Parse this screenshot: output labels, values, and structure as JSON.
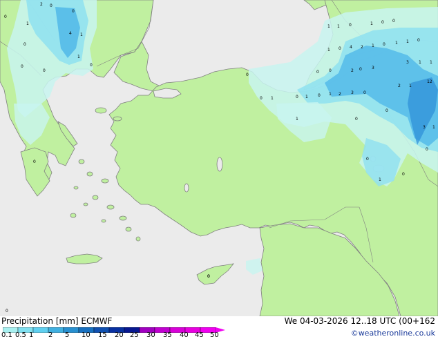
{
  "footer": {
    "title": "Precipitation [mm]  ECMWF",
    "datetime": "We 04-03-2026 12..18 UTC (00+162",
    "credit": "©weatheronline.co.uk"
  },
  "legend": {
    "ticks": [
      "0.1",
      "0.5",
      "1",
      "2",
      "5",
      "10",
      "15",
      "20",
      "25",
      "30",
      "35",
      "40",
      "45",
      "50"
    ],
    "colors": [
      "#a8f0f0",
      "#80e0f0",
      "#60d0f0",
      "#40b0e0",
      "#2890d0",
      "#1870c0",
      "#1050b0",
      "#0830a0",
      "#081890",
      "#a000c0",
      "#c000d0",
      "#d800d8",
      "#e800e0",
      "#f000f0"
    ]
  },
  "colors": {
    "sea": "#ebebeb",
    "land": "#c0f0a0",
    "coast": "#808080",
    "rain_light": "#c8f5f0",
    "rain_mid": "#8ee0f0",
    "rain_heavy": "#50b8e8",
    "rain_core": "#3090d8"
  },
  "precip_labels": [
    {
      "t": "0"
    },
    {
      "t": "2"
    },
    {
      "t": "0"
    },
    {
      "t": "0"
    },
    {
      "t": "1"
    },
    {
      "t": "4"
    },
    {
      "t": "1"
    },
    {
      "t": "0"
    },
    {
      "t": "1"
    },
    {
      "t": "0"
    },
    {
      "t": "0"
    },
    {
      "t": "0"
    },
    {
      "t": "0"
    },
    {
      "t": "0"
    },
    {
      "t": "1"
    },
    {
      "t": "1"
    },
    {
      "t": "0"
    },
    {
      "t": "1"
    },
    {
      "t": "0"
    },
    {
      "t": "0"
    },
    {
      "t": "1"
    },
    {
      "t": "0"
    },
    {
      "t": "4"
    },
    {
      "t": "2"
    },
    {
      "t": "1"
    },
    {
      "t": "0"
    },
    {
      "t": "1"
    },
    {
      "t": "1"
    },
    {
      "t": "0"
    },
    {
      "t": "0"
    },
    {
      "t": "0"
    },
    {
      "t": "0"
    },
    {
      "t": "2"
    },
    {
      "t": "0"
    },
    {
      "t": "3"
    },
    {
      "t": "3"
    },
    {
      "t": "1"
    },
    {
      "t": "1"
    },
    {
      "t": "2"
    },
    {
      "t": "1"
    },
    {
      "t": "12"
    },
    {
      "t": "0"
    },
    {
      "t": "1"
    },
    {
      "t": "0"
    },
    {
      "t": "1"
    },
    {
      "t": "2"
    },
    {
      "t": "3"
    },
    {
      "t": "0"
    },
    {
      "t": "0"
    },
    {
      "t": "1"
    },
    {
      "t": "1"
    },
    {
      "t": "0"
    },
    {
      "t": "0"
    },
    {
      "t": "3"
    },
    {
      "t": "1"
    },
    {
      "t": "0"
    },
    {
      "t": "0"
    },
    {
      "t": "1"
    },
    {
      "t": "0"
    },
    {
      "t": "0"
    },
    {
      "t": "0"
    },
    {
      "t": "0"
    }
  ]
}
